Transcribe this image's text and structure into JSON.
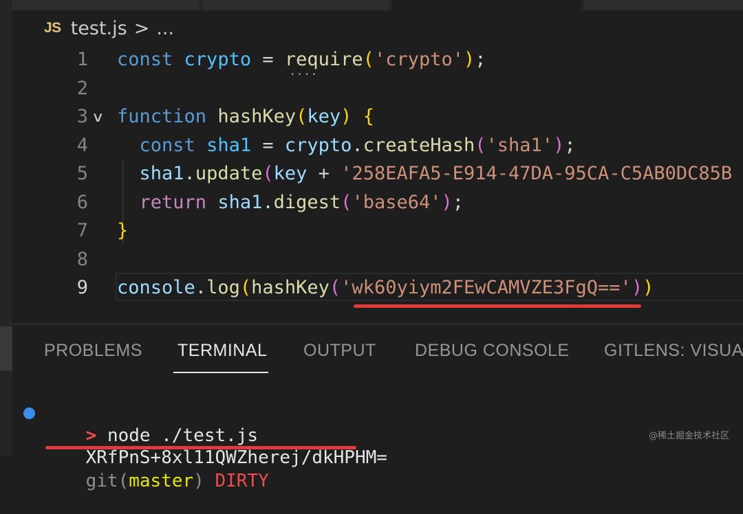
{
  "breadcrumb": {
    "language_badge": "JS",
    "file": "test.js",
    "separator": ">",
    "more": "..."
  },
  "editor": {
    "current_line": 9,
    "lines": [
      {
        "number": "1",
        "tokens": [
          {
            "t": "const",
            "c": "k"
          },
          {
            "t": " ",
            "c": "t"
          },
          {
            "t": "crypto",
            "c": "v"
          },
          {
            "t": " = ",
            "c": "t"
          },
          {
            "t": "require",
            "c": "f"
          },
          {
            "t": "(",
            "c": "b1"
          },
          {
            "t": "'crypto'",
            "c": "s"
          },
          {
            "t": ")",
            "c": "b1"
          },
          {
            "t": ";",
            "c": "t"
          }
        ]
      },
      {
        "number": "2",
        "tokens": []
      },
      {
        "number": "3",
        "fold": "∨",
        "tokens": [
          {
            "t": "function",
            "c": "k"
          },
          {
            "t": " ",
            "c": "t"
          },
          {
            "t": "hashKey",
            "c": "f"
          },
          {
            "t": "(",
            "c": "b1"
          },
          {
            "t": "key",
            "c": "p"
          },
          {
            "t": ")",
            "c": "b1"
          },
          {
            "t": " ",
            "c": "t"
          },
          {
            "t": "{",
            "c": "b1"
          }
        ]
      },
      {
        "number": "4",
        "tokens": [
          {
            "t": "  ",
            "c": "t"
          },
          {
            "t": "const",
            "c": "k"
          },
          {
            "t": " ",
            "c": "t"
          },
          {
            "t": "sha1",
            "c": "v"
          },
          {
            "t": " = ",
            "c": "t"
          },
          {
            "t": "crypto",
            "c": "p"
          },
          {
            "t": ".",
            "c": "t"
          },
          {
            "t": "createHash",
            "c": "f"
          },
          {
            "t": "(",
            "c": "b2"
          },
          {
            "t": "'sha1'",
            "c": "s"
          },
          {
            "t": ")",
            "c": "b2"
          },
          {
            "t": ";",
            "c": "t"
          }
        ]
      },
      {
        "number": "5",
        "tokens": [
          {
            "t": "  ",
            "c": "t"
          },
          {
            "t": "sha1",
            "c": "p"
          },
          {
            "t": ".",
            "c": "t"
          },
          {
            "t": "update",
            "c": "f"
          },
          {
            "t": "(",
            "c": "b2"
          },
          {
            "t": "key",
            "c": "p"
          },
          {
            "t": " + ",
            "c": "t"
          },
          {
            "t": "'258EAFA5-E914-47DA-95CA-C5AB0DC85B",
            "c": "s"
          }
        ]
      },
      {
        "number": "6",
        "tokens": [
          {
            "t": "  ",
            "c": "t"
          },
          {
            "t": "return",
            "c": "kc"
          },
          {
            "t": " ",
            "c": "t"
          },
          {
            "t": "sha1",
            "c": "p"
          },
          {
            "t": ".",
            "c": "t"
          },
          {
            "t": "digest",
            "c": "f"
          },
          {
            "t": "(",
            "c": "b2"
          },
          {
            "t": "'base64'",
            "c": "s"
          },
          {
            "t": ")",
            "c": "b2"
          },
          {
            "t": ";",
            "c": "t"
          }
        ]
      },
      {
        "number": "7",
        "tokens": [
          {
            "t": "}",
            "c": "b1"
          }
        ]
      },
      {
        "number": "8",
        "tokens": []
      },
      {
        "number": "9",
        "tokens": [
          {
            "t": "console",
            "c": "p"
          },
          {
            "t": ".",
            "c": "t"
          },
          {
            "t": "log",
            "c": "f"
          },
          {
            "t": "(",
            "c": "b1"
          },
          {
            "t": "hashKey",
            "c": "f"
          },
          {
            "t": "(",
            "c": "b2"
          },
          {
            "t": "'wk60yiym2FEwCAMVZE3FgQ=='",
            "c": "s"
          },
          {
            "t": ")",
            "c": "b2"
          },
          {
            "t": ")",
            "c": "b1"
          }
        ]
      }
    ]
  },
  "panel": {
    "tabs": [
      "PROBLEMS",
      "TERMINAL",
      "OUTPUT",
      "DEBUG CONSOLE",
      "GITLENS: VISUAL"
    ],
    "active_tab": "TERMINAL"
  },
  "terminal": {
    "prompt_symbol": ">",
    "command": "node ./test.js",
    "output": "XRfPnS+8xl11QWZherej/dkHPHM=",
    "git_prefix": "git(",
    "git_branch": "master",
    "git_suffix": ")",
    "git_status": "DIRTY"
  },
  "watermark": "@稀土掘金技术社区",
  "colors": {
    "background": "#1e1e1e",
    "keyword": "#569cd6",
    "string": "#ce9178",
    "function": "#dcdcaa",
    "annotation_underline": "#e03a3a",
    "terminal_dot": "#3b8eea"
  }
}
